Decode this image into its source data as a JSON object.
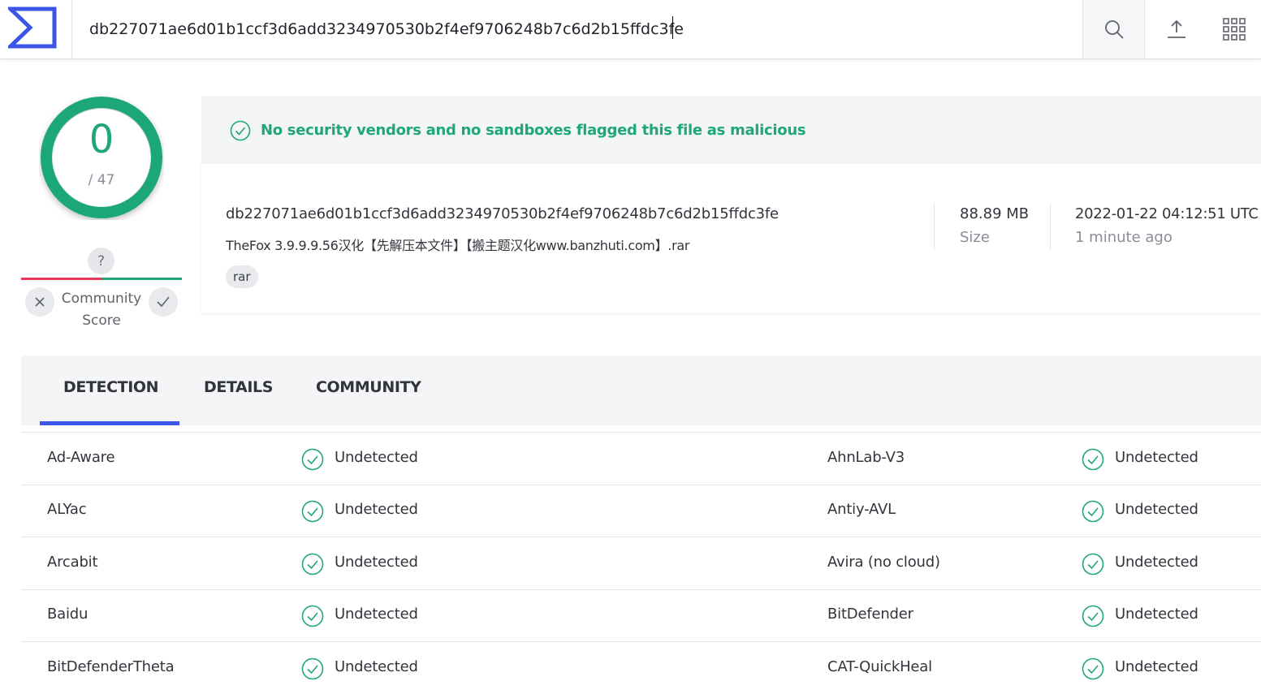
{
  "search": {
    "value": "db227071ae6d01b1ccf3d6add3234970530b2f4ef9706248b7c6d2b15ffdc3fe"
  },
  "score": {
    "detections": "0",
    "total": "/ 47"
  },
  "community": {
    "unknown": "?",
    "label_line1": "Community",
    "label_line2": "Score"
  },
  "banner": {
    "message": "No security vendors and no sandboxes flagged this file as malicious"
  },
  "file": {
    "hash": "db227071ae6d01b1ccf3d6add3234970530b2f4ef9706248b7c6d2b15ffdc3fe",
    "name": "TheFox 3.9.9.9.56汉化【先解压本文件】【搬主题汉化www.banzhuti.com】.rar",
    "tag": "rar",
    "size_value": "88.89 MB",
    "size_label": "Size",
    "date_value": "2022-01-22 04:12:51 UTC",
    "date_label": "1 minute ago"
  },
  "tabs": [
    {
      "label": "DETECTION"
    },
    {
      "label": "DETAILS"
    },
    {
      "label": "COMMUNITY"
    }
  ],
  "detections": [
    {
      "left_vendor": "Ad-Aware",
      "left_result": "Undetected",
      "right_vendor": "AhnLab-V3",
      "right_result": "Undetected"
    },
    {
      "left_vendor": "ALYac",
      "left_result": "Undetected",
      "right_vendor": "Antiy-AVL",
      "right_result": "Undetected"
    },
    {
      "left_vendor": "Arcabit",
      "left_result": "Undetected",
      "right_vendor": "Avira (no cloud)",
      "right_result": "Undetected"
    },
    {
      "left_vendor": "Baidu",
      "left_result": "Undetected",
      "right_vendor": "BitDefender",
      "right_result": "Undetected"
    },
    {
      "left_vendor": "BitDefenderTheta",
      "left_result": "Undetected",
      "right_vendor": "CAT-QuickHeal",
      "right_result": "Undetected"
    }
  ],
  "colors": {
    "accent": "#3b55e6",
    "clean": "#1fa776",
    "malicious": "#e9375b"
  }
}
